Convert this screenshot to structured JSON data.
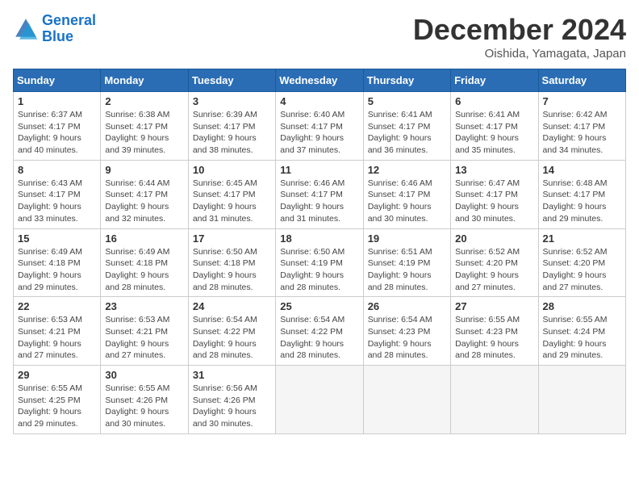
{
  "header": {
    "logo_line1": "General",
    "logo_line2": "Blue",
    "month": "December 2024",
    "location": "Oishida, Yamagata, Japan"
  },
  "days_of_week": [
    "Sunday",
    "Monday",
    "Tuesday",
    "Wednesday",
    "Thursday",
    "Friday",
    "Saturday"
  ],
  "weeks": [
    [
      {
        "day": "1",
        "sunrise": "6:37 AM",
        "sunset": "4:17 PM",
        "daylight": "9 hours and 40 minutes."
      },
      {
        "day": "2",
        "sunrise": "6:38 AM",
        "sunset": "4:17 PM",
        "daylight": "9 hours and 39 minutes."
      },
      {
        "day": "3",
        "sunrise": "6:39 AM",
        "sunset": "4:17 PM",
        "daylight": "9 hours and 38 minutes."
      },
      {
        "day": "4",
        "sunrise": "6:40 AM",
        "sunset": "4:17 PM",
        "daylight": "9 hours and 37 minutes."
      },
      {
        "day": "5",
        "sunrise": "6:41 AM",
        "sunset": "4:17 PM",
        "daylight": "9 hours and 36 minutes."
      },
      {
        "day": "6",
        "sunrise": "6:41 AM",
        "sunset": "4:17 PM",
        "daylight": "9 hours and 35 minutes."
      },
      {
        "day": "7",
        "sunrise": "6:42 AM",
        "sunset": "4:17 PM",
        "daylight": "9 hours and 34 minutes."
      }
    ],
    [
      {
        "day": "8",
        "sunrise": "6:43 AM",
        "sunset": "4:17 PM",
        "daylight": "9 hours and 33 minutes."
      },
      {
        "day": "9",
        "sunrise": "6:44 AM",
        "sunset": "4:17 PM",
        "daylight": "9 hours and 32 minutes."
      },
      {
        "day": "10",
        "sunrise": "6:45 AM",
        "sunset": "4:17 PM",
        "daylight": "9 hours and 31 minutes."
      },
      {
        "day": "11",
        "sunrise": "6:46 AM",
        "sunset": "4:17 PM",
        "daylight": "9 hours and 31 minutes."
      },
      {
        "day": "12",
        "sunrise": "6:46 AM",
        "sunset": "4:17 PM",
        "daylight": "9 hours and 30 minutes."
      },
      {
        "day": "13",
        "sunrise": "6:47 AM",
        "sunset": "4:17 PM",
        "daylight": "9 hours and 30 minutes."
      },
      {
        "day": "14",
        "sunrise": "6:48 AM",
        "sunset": "4:17 PM",
        "daylight": "9 hours and 29 minutes."
      }
    ],
    [
      {
        "day": "15",
        "sunrise": "6:49 AM",
        "sunset": "4:18 PM",
        "daylight": "9 hours and 29 minutes."
      },
      {
        "day": "16",
        "sunrise": "6:49 AM",
        "sunset": "4:18 PM",
        "daylight": "9 hours and 28 minutes."
      },
      {
        "day": "17",
        "sunrise": "6:50 AM",
        "sunset": "4:18 PM",
        "daylight": "9 hours and 28 minutes."
      },
      {
        "day": "18",
        "sunrise": "6:50 AM",
        "sunset": "4:19 PM",
        "daylight": "9 hours and 28 minutes."
      },
      {
        "day": "19",
        "sunrise": "6:51 AM",
        "sunset": "4:19 PM",
        "daylight": "9 hours and 28 minutes."
      },
      {
        "day": "20",
        "sunrise": "6:52 AM",
        "sunset": "4:20 PM",
        "daylight": "9 hours and 27 minutes."
      },
      {
        "day": "21",
        "sunrise": "6:52 AM",
        "sunset": "4:20 PM",
        "daylight": "9 hours and 27 minutes."
      }
    ],
    [
      {
        "day": "22",
        "sunrise": "6:53 AM",
        "sunset": "4:21 PM",
        "daylight": "9 hours and 27 minutes."
      },
      {
        "day": "23",
        "sunrise": "6:53 AM",
        "sunset": "4:21 PM",
        "daylight": "9 hours and 27 minutes."
      },
      {
        "day": "24",
        "sunrise": "6:54 AM",
        "sunset": "4:22 PM",
        "daylight": "9 hours and 28 minutes."
      },
      {
        "day": "25",
        "sunrise": "6:54 AM",
        "sunset": "4:22 PM",
        "daylight": "9 hours and 28 minutes."
      },
      {
        "day": "26",
        "sunrise": "6:54 AM",
        "sunset": "4:23 PM",
        "daylight": "9 hours and 28 minutes."
      },
      {
        "day": "27",
        "sunrise": "6:55 AM",
        "sunset": "4:23 PM",
        "daylight": "9 hours and 28 minutes."
      },
      {
        "day": "28",
        "sunrise": "6:55 AM",
        "sunset": "4:24 PM",
        "daylight": "9 hours and 29 minutes."
      }
    ],
    [
      {
        "day": "29",
        "sunrise": "6:55 AM",
        "sunset": "4:25 PM",
        "daylight": "9 hours and 29 minutes."
      },
      {
        "day": "30",
        "sunrise": "6:55 AM",
        "sunset": "4:26 PM",
        "daylight": "9 hours and 30 minutes."
      },
      {
        "day": "31",
        "sunrise": "6:56 AM",
        "sunset": "4:26 PM",
        "daylight": "9 hours and 30 minutes."
      },
      null,
      null,
      null,
      null
    ]
  ]
}
